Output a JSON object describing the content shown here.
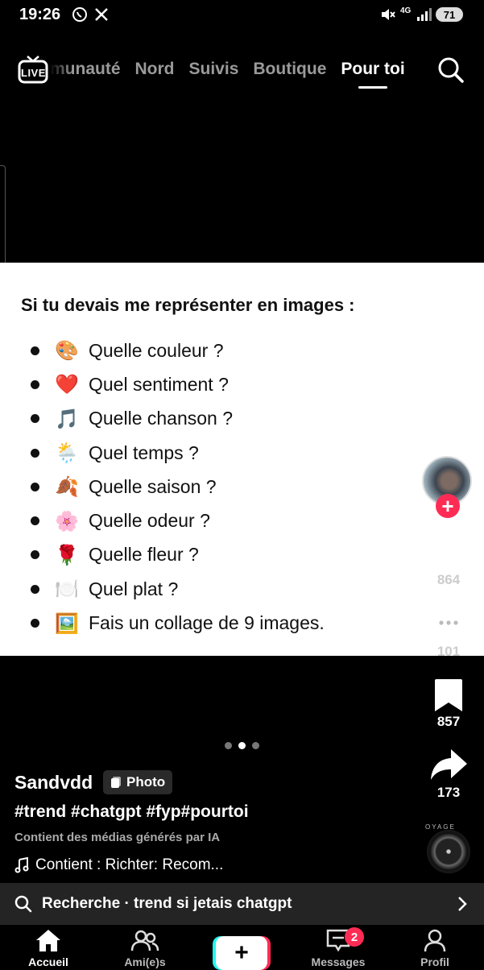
{
  "status_bar": {
    "time": "19:26",
    "network": "4G",
    "battery": "71",
    "notification_icons": [
      "whatsapp-icon",
      "x-icon"
    ]
  },
  "top_nav": {
    "live_label": "LIVE",
    "tabs": [
      {
        "label": "munauté"
      },
      {
        "label": "Nord"
      },
      {
        "label": "Suivis"
      },
      {
        "label": "Boutique"
      },
      {
        "label": "Pour toi",
        "active": true
      }
    ]
  },
  "post": {
    "title": "Si tu devais me représenter en images :",
    "questions": [
      {
        "emoji": "🎨",
        "text": "Quelle couleur ?"
      },
      {
        "emoji": "❤️",
        "text": "Quel sentiment ?"
      },
      {
        "emoji": "🎵",
        "text": "Quelle chanson ?"
      },
      {
        "emoji": "🌦️",
        "text": "Quel temps ?"
      },
      {
        "emoji": "🍂",
        "text": "Quelle saison ?"
      },
      {
        "emoji": "🌸",
        "text": "Quelle odeur ?"
      },
      {
        "emoji": "🌹",
        "text": "Quelle fleur ?"
      },
      {
        "emoji": "🍽️",
        "text": "Quel plat ?"
      },
      {
        "emoji": "🖼️",
        "text": "Fais un collage de 9 images."
      }
    ],
    "carousel_pages": 3,
    "carousel_current": 2
  },
  "actions": {
    "likes": "864",
    "comments": "101",
    "saves": "857",
    "shares": "173",
    "music_disc_text": "OYAGE"
  },
  "caption": {
    "author": "Sandvdd",
    "type_badge": "Photo",
    "hashtags": "#trend #chatgpt #fyp#pourtoi",
    "ai_notice": "Contient des médias générés par IA",
    "sound": "Contient : Richter: Recom..."
  },
  "search_suggestion": {
    "text": "Recherche · trend si jetais chatgpt"
  },
  "bottom_nav": {
    "items": [
      {
        "label": "Accueil",
        "icon": "home-icon"
      },
      {
        "label": "Ami(e)s",
        "icon": "friends-icon"
      },
      {
        "label": "",
        "icon": "create-plus-icon"
      },
      {
        "label": "Messages",
        "icon": "inbox-icon",
        "badge": "2"
      },
      {
        "label": "Profil",
        "icon": "profile-icon"
      }
    ]
  },
  "colors": {
    "accent": "#fe2c55",
    "cyan": "#25f4ee",
    "background": "#000000"
  }
}
